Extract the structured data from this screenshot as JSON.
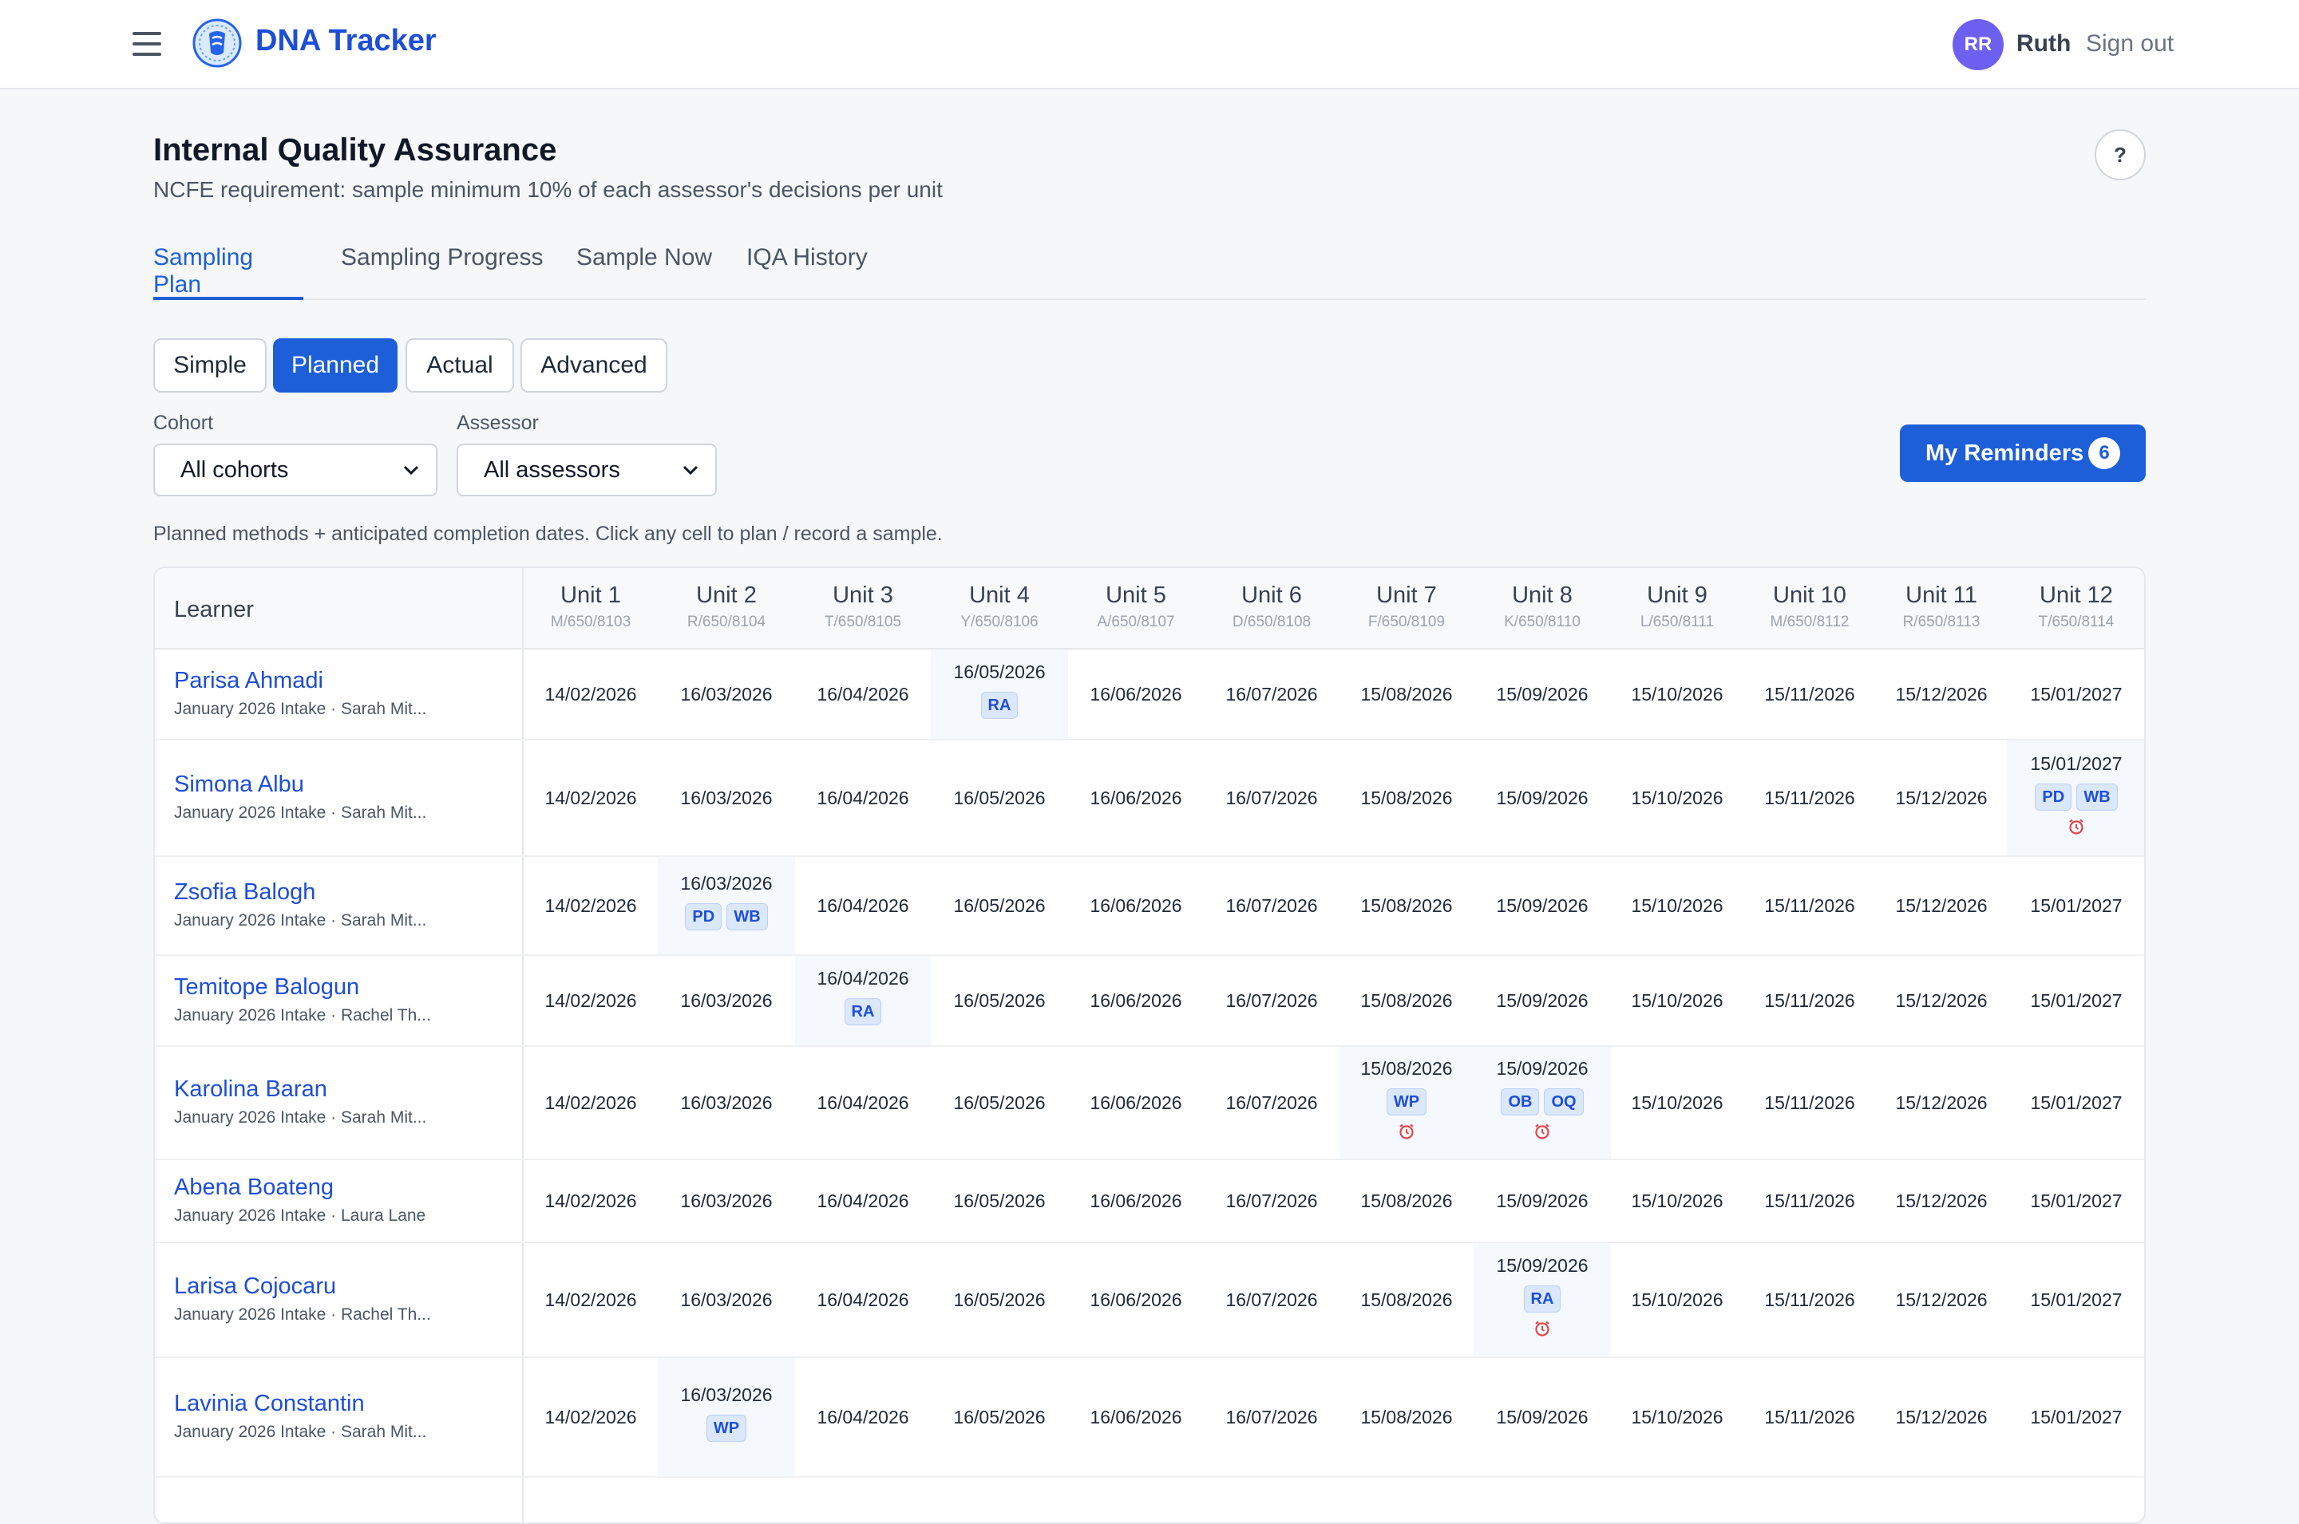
{
  "header": {
    "brand": "DNA Tracker",
    "avatar_initials": "RR",
    "user_name": "Ruth",
    "sign_out": "Sign out"
  },
  "page": {
    "title": "Internal Quality Assurance",
    "subtitle": "NCFE requirement: sample minimum 10% of each assessor's decisions per unit",
    "help": "?"
  },
  "tabs": [
    {
      "label": "Sampling Plan",
      "active": true
    },
    {
      "label": "Sampling Progress",
      "active": false
    },
    {
      "label": "Sample Now",
      "active": false
    },
    {
      "label": "IQA History",
      "active": false
    }
  ],
  "views": [
    {
      "label": "Simple",
      "active": false
    },
    {
      "label": "Planned",
      "active": true
    },
    {
      "label": "Actual",
      "active": false
    },
    {
      "label": "Advanced",
      "active": false
    }
  ],
  "filters": {
    "cohort_label": "Cohort",
    "cohort_value": "All cohorts",
    "assessor_label": "Assessor",
    "assessor_value": "All assessors"
  },
  "reminders": {
    "label": "My Reminders",
    "count": "6"
  },
  "hint": "Planned methods + anticipated completion dates. Click any cell to plan / record a sample.",
  "colors": {
    "accent": "#1d5fd9",
    "avatar": "#6d5ff0",
    "tag_bg": "#dbe7fb",
    "alarm": "#e0464a"
  },
  "grid": {
    "learner_header": "Learner",
    "units": [
      {
        "name": "Unit 1",
        "code": "M/650/8103"
      },
      {
        "name": "Unit 2",
        "code": "R/650/8104"
      },
      {
        "name": "Unit 3",
        "code": "T/650/8105"
      },
      {
        "name": "Unit 4",
        "code": "Y/650/8106"
      },
      {
        "name": "Unit 5",
        "code": "A/650/8107"
      },
      {
        "name": "Unit 6",
        "code": "D/650/8108"
      },
      {
        "name": "Unit 7",
        "code": "F/650/8109"
      },
      {
        "name": "Unit 8",
        "code": "K/650/8110"
      },
      {
        "name": "Unit 9",
        "code": "L/650/8111"
      },
      {
        "name": "Unit 10",
        "code": "M/650/8112"
      },
      {
        "name": "Unit 11",
        "code": "R/650/8113"
      },
      {
        "name": "Unit 12",
        "code": "T/650/8114"
      }
    ],
    "rows": [
      {
        "name": "Parisa Ahmadi",
        "sub": "January 2026 Intake · Sarah Mit...",
        "dates": [
          "14/02/2026",
          "16/03/2026",
          "16/04/2026",
          "16/05/2026",
          "16/06/2026",
          "16/07/2026",
          "15/08/2026",
          "15/09/2026",
          "15/10/2026",
          "15/11/2026",
          "15/12/2026",
          "15/01/2027"
        ],
        "planned": {
          "3": {
            "tags": [
              "RA"
            ],
            "alarm": false
          }
        }
      },
      {
        "name": "Simona Albu",
        "sub": "January 2026 Intake · Sarah Mit...",
        "dates": [
          "14/02/2026",
          "16/03/2026",
          "16/04/2026",
          "16/05/2026",
          "16/06/2026",
          "16/07/2026",
          "15/08/2026",
          "15/09/2026",
          "15/10/2026",
          "15/11/2026",
          "15/12/2026",
          "15/01/2027"
        ],
        "planned": {
          "11": {
            "tags": [
              "PD",
              "WB"
            ],
            "alarm": true
          }
        }
      },
      {
        "name": "Zsofia Balogh",
        "sub": "January 2026 Intake · Sarah Mit...",
        "dates": [
          "14/02/2026",
          "16/03/2026",
          "16/04/2026",
          "16/05/2026",
          "16/06/2026",
          "16/07/2026",
          "15/08/2026",
          "15/09/2026",
          "15/10/2026",
          "15/11/2026",
          "15/12/2026",
          "15/01/2027"
        ],
        "planned": {
          "1": {
            "tags": [
              "PD",
              "WB"
            ],
            "alarm": false
          }
        }
      },
      {
        "name": "Temitope Balogun",
        "sub": "January 2026 Intake · Rachel Th...",
        "dates": [
          "14/02/2026",
          "16/03/2026",
          "16/04/2026",
          "16/05/2026",
          "16/06/2026",
          "16/07/2026",
          "15/08/2026",
          "15/09/2026",
          "15/10/2026",
          "15/11/2026",
          "15/12/2026",
          "15/01/2027"
        ],
        "planned": {
          "2": {
            "tags": [
              "RA"
            ],
            "alarm": false
          }
        }
      },
      {
        "name": "Karolina Baran",
        "sub": "January 2026 Intake · Sarah Mit...",
        "dates": [
          "14/02/2026",
          "16/03/2026",
          "16/04/2026",
          "16/05/2026",
          "16/06/2026",
          "16/07/2026",
          "15/08/2026",
          "15/09/2026",
          "15/10/2026",
          "15/11/2026",
          "15/12/2026",
          "15/01/2027"
        ],
        "planned": {
          "6": {
            "tags": [
              "WP"
            ],
            "alarm": true
          },
          "7": {
            "tags": [
              "OB",
              "OQ"
            ],
            "alarm": true
          }
        }
      },
      {
        "name": "Abena Boateng",
        "sub": "January 2026 Intake · Laura Lane",
        "dates": [
          "14/02/2026",
          "16/03/2026",
          "16/04/2026",
          "16/05/2026",
          "16/06/2026",
          "16/07/2026",
          "15/08/2026",
          "15/09/2026",
          "15/10/2026",
          "15/11/2026",
          "15/12/2026",
          "15/01/2027"
        ],
        "planned": {}
      },
      {
        "name": "Larisa Cojocaru",
        "sub": "January 2026 Intake · Rachel Th...",
        "dates": [
          "14/02/2026",
          "16/03/2026",
          "16/04/2026",
          "16/05/2026",
          "16/06/2026",
          "16/07/2026",
          "15/08/2026",
          "15/09/2026",
          "15/10/2026",
          "15/11/2026",
          "15/12/2026",
          "15/01/2027"
        ],
        "planned": {
          "7": {
            "tags": [
              "RA"
            ],
            "alarm": true
          }
        }
      },
      {
        "name": "Lavinia Constantin",
        "sub": "January 2026 Intake · Sarah Mit...",
        "dates": [
          "14/02/2026",
          "16/03/2026",
          "16/04/2026",
          "16/05/2026",
          "16/06/2026",
          "16/07/2026",
          "15/08/2026",
          "15/09/2026",
          "15/10/2026",
          "15/11/2026",
          "15/12/2026",
          "15/01/2027"
        ],
        "planned": {
          "1": {
            "tags": [
              "WP"
            ],
            "alarm": false
          }
        }
      }
    ]
  }
}
